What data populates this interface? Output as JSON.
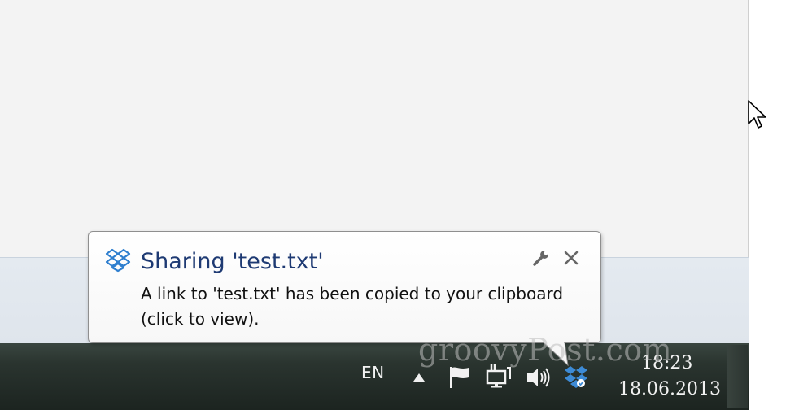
{
  "notification": {
    "title": "Sharing 'test.txt'",
    "message": "A link to 'test.txt' has been copied to your clipboard (click to view).",
    "app_icon": "dropbox-icon",
    "options_icon": "wrench-icon",
    "close_icon": "close-icon"
  },
  "taskbar": {
    "language": "EN",
    "clock_time": "18:23",
    "clock_date": "18.06.2013",
    "tray_icons": [
      "show-hidden-icons-arrow",
      "action-center-flag-icon",
      "network-icon",
      "volume-icon",
      "dropbox-tray-icon"
    ]
  },
  "watermark": "groovyPost.com",
  "colors": {
    "title": "#1e3a73",
    "taskbar": "#1c2420",
    "dropbox_blue": "#3d8bd6"
  }
}
